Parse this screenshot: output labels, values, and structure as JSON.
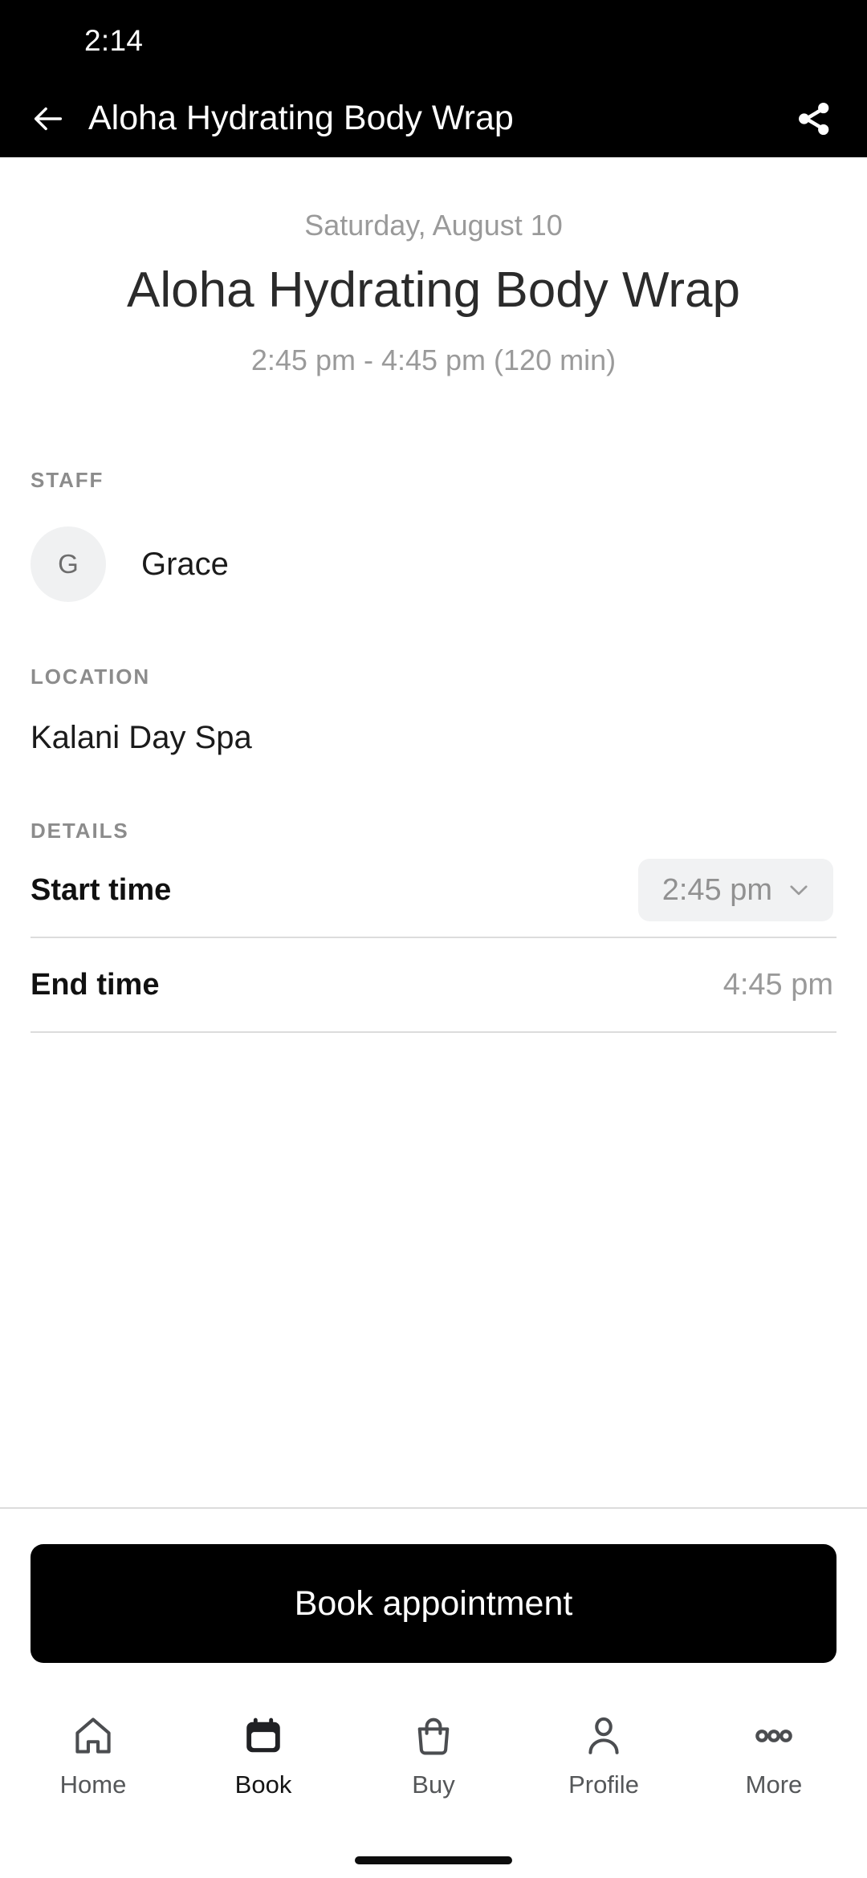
{
  "status_bar": {
    "time": "2:14"
  },
  "app_bar": {
    "title": "Aloha Hydrating Body Wrap",
    "back_icon": "arrow-left-icon",
    "share_icon": "share-icon"
  },
  "hero": {
    "date": "Saturday, August 10",
    "title": "Aloha Hydrating Body Wrap",
    "time_range": "2:45 pm - 4:45 pm (120 min)"
  },
  "staff": {
    "label": "STAFF",
    "avatar_initial": "G",
    "name": "Grace"
  },
  "location": {
    "label": "LOCATION",
    "value": "Kalani Day Spa"
  },
  "details": {
    "label": "DETAILS",
    "rows": [
      {
        "label": "Start time",
        "value": "2:45 pm",
        "type": "dropdown",
        "chevron_icon": "chevron-down-icon"
      },
      {
        "label": "End time",
        "value": "4:45 pm",
        "type": "text"
      }
    ]
  },
  "footer": {
    "cta_label": "Book appointment"
  },
  "bottom_nav": {
    "items": [
      {
        "label": "Home",
        "icon": "home-icon",
        "active": false
      },
      {
        "label": "Book",
        "icon": "calendar-icon",
        "active": true
      },
      {
        "label": "Buy",
        "icon": "bag-icon",
        "active": false
      },
      {
        "label": "Profile",
        "icon": "person-icon",
        "active": false
      },
      {
        "label": "More",
        "icon": "ellipsis-icon",
        "active": false
      }
    ]
  },
  "colors": {
    "bar_background": "#000000",
    "accent": "#000000",
    "muted_text": "#9a9a9a",
    "chip_background": "#f1f2f3",
    "avatar_background": "#f0f1f2",
    "divider": "#dcdcdc"
  }
}
